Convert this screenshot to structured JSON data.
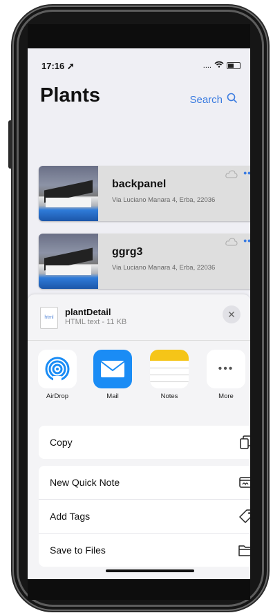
{
  "status": {
    "time": "17:16 ➚",
    "signal": "...."
  },
  "header": {
    "title": "Plants",
    "search_label": "Search"
  },
  "cards": [
    {
      "name": "backpanel",
      "address": "Via Luciano Manara 4, Erba, 22036"
    },
    {
      "name": "ggrg3",
      "address": "Via Luciano Manara 4, Erba, 22036"
    }
  ],
  "sheet": {
    "file_name": "plantDetail",
    "file_meta": "HTML text - 11 KB",
    "file_icon_text": "html",
    "apps": [
      {
        "label": "AirDrop",
        "icon": "airdrop-icon"
      },
      {
        "label": "Mail",
        "icon": "mail-icon"
      },
      {
        "label": "Notes",
        "icon": "notes-icon"
      },
      {
        "label": "More",
        "icon": "more-icon"
      }
    ],
    "actions_top": [
      {
        "label": "Copy",
        "icon": "copy-icon"
      }
    ],
    "actions": [
      {
        "label": "New Quick Note",
        "icon": "quick-note-icon"
      },
      {
        "label": "Add Tags",
        "icon": "tag-icon"
      },
      {
        "label": "Save to Files",
        "icon": "folder-icon"
      }
    ]
  },
  "colors": {
    "accent": "#3a7be0",
    "mail": "#1a8cf5",
    "notes_yellow": "#f5c518"
  }
}
